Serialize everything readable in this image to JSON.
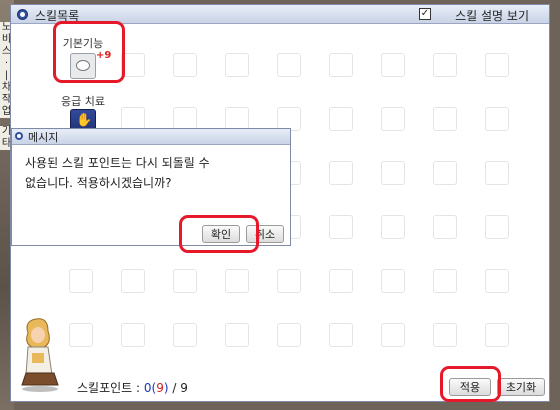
{
  "left_sidebar": {
    "chars_top": [
      "노",
      "비",
      "스",
      "·",
      "|",
      "차",
      "작",
      "업"
    ],
    "chars_bottom": [
      "기",
      "타"
    ]
  },
  "skill_window": {
    "title": "스킬목록",
    "show_description_label": "스킬 설명 보기",
    "show_description_checked": true,
    "skills": [
      {
        "name": "기본기능",
        "level_badge": "+9",
        "icon": "speech-bubble-icon"
      },
      {
        "name": "응급 치료",
        "icon": "healing-hand-icon"
      }
    ],
    "skill_points": {
      "label": "스킬포인트 : ",
      "value": "0",
      "paren_open": "(",
      "remaining": "9",
      "paren_close": ")",
      "separator": " / ",
      "total": "9"
    },
    "apply_label": "적용",
    "reset_label": "초기화"
  },
  "message_dialog": {
    "title": "메시지",
    "line1": "사용된 스킬 포인트는 다시 되돌릴 수",
    "line2": "없습니다. 적용하시겠습니까?",
    "confirm_label": "확인",
    "cancel_label": "취소"
  },
  "colors": {
    "highlight": "#e6192b",
    "points_value": "#1d37b5",
    "points_remaining": "#d21d1d"
  }
}
